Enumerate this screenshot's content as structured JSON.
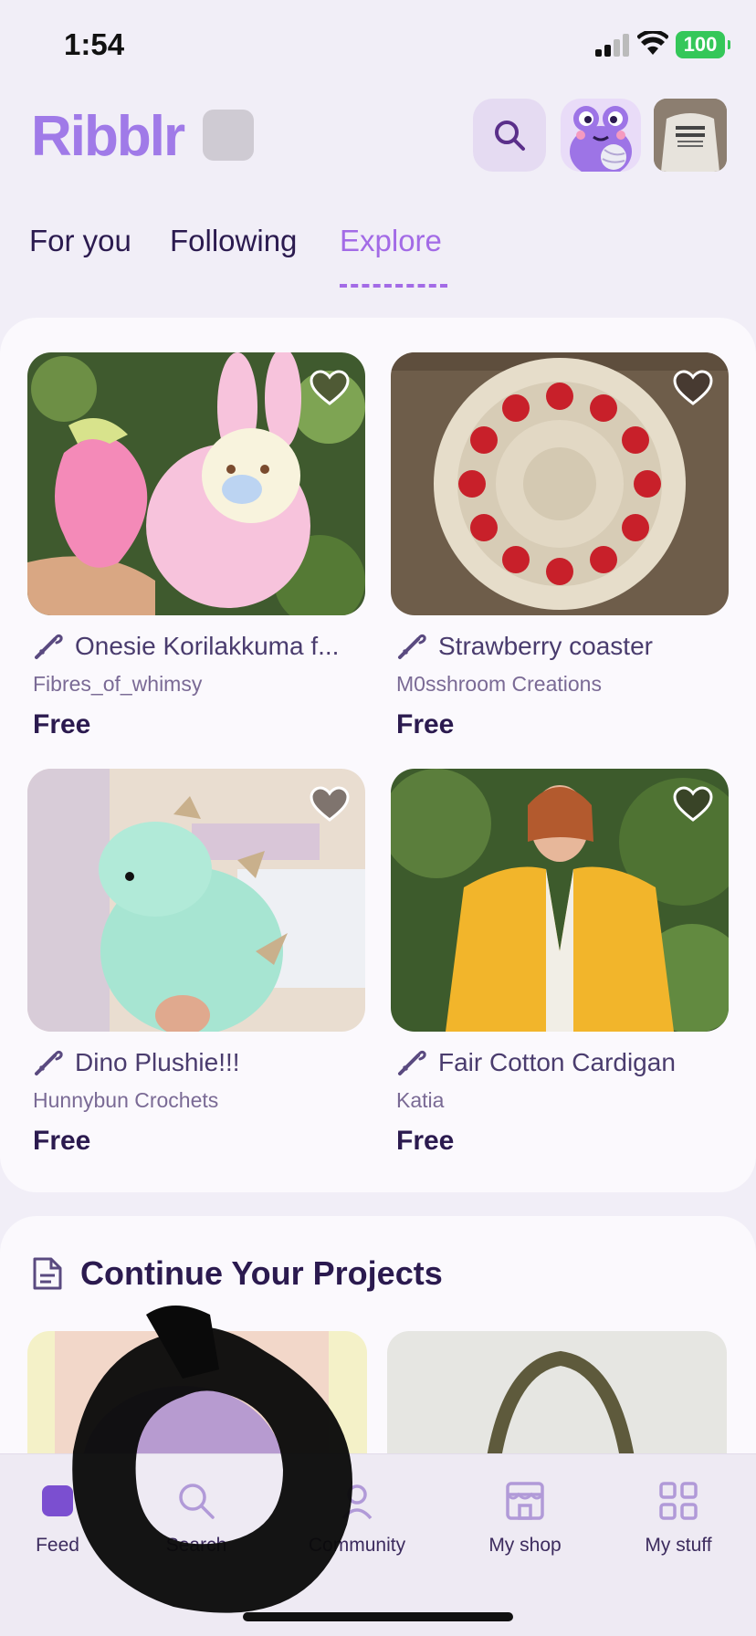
{
  "status_bar": {
    "time": "1:54",
    "battery": "100"
  },
  "header": {
    "logo": "Ribblr"
  },
  "tabs": [
    {
      "label": "For you",
      "active": false
    },
    {
      "label": "Following",
      "active": false
    },
    {
      "label": "Explore",
      "active": true
    }
  ],
  "products": [
    {
      "title": "Onesie Korilakkuma f...",
      "seller": "Fibres_of_whimsy",
      "price": "Free"
    },
    {
      "title": "Strawberry coaster",
      "seller": "M0sshroom Creations",
      "price": "Free"
    },
    {
      "title": "Dino Plushie!!!",
      "seller": "Hunnybun Crochets",
      "price": "Free"
    },
    {
      "title": "Fair Cotton Cardigan",
      "seller": "Katia",
      "price": "Free"
    }
  ],
  "continue_projects": {
    "title": "Continue Your Projects"
  },
  "bottom_nav": [
    {
      "label": "Feed",
      "icon": "feed-icon"
    },
    {
      "label": "Search",
      "icon": "search-icon"
    },
    {
      "label": "Community",
      "icon": "community-icon"
    },
    {
      "label": "My shop",
      "icon": "shop-icon"
    },
    {
      "label": "My stuff",
      "icon": "grid-icon"
    }
  ],
  "colors": {
    "accent": "#a36be6",
    "logo": "#a07ae8",
    "text": "#2b1a4f",
    "battery": "#35c759"
  }
}
